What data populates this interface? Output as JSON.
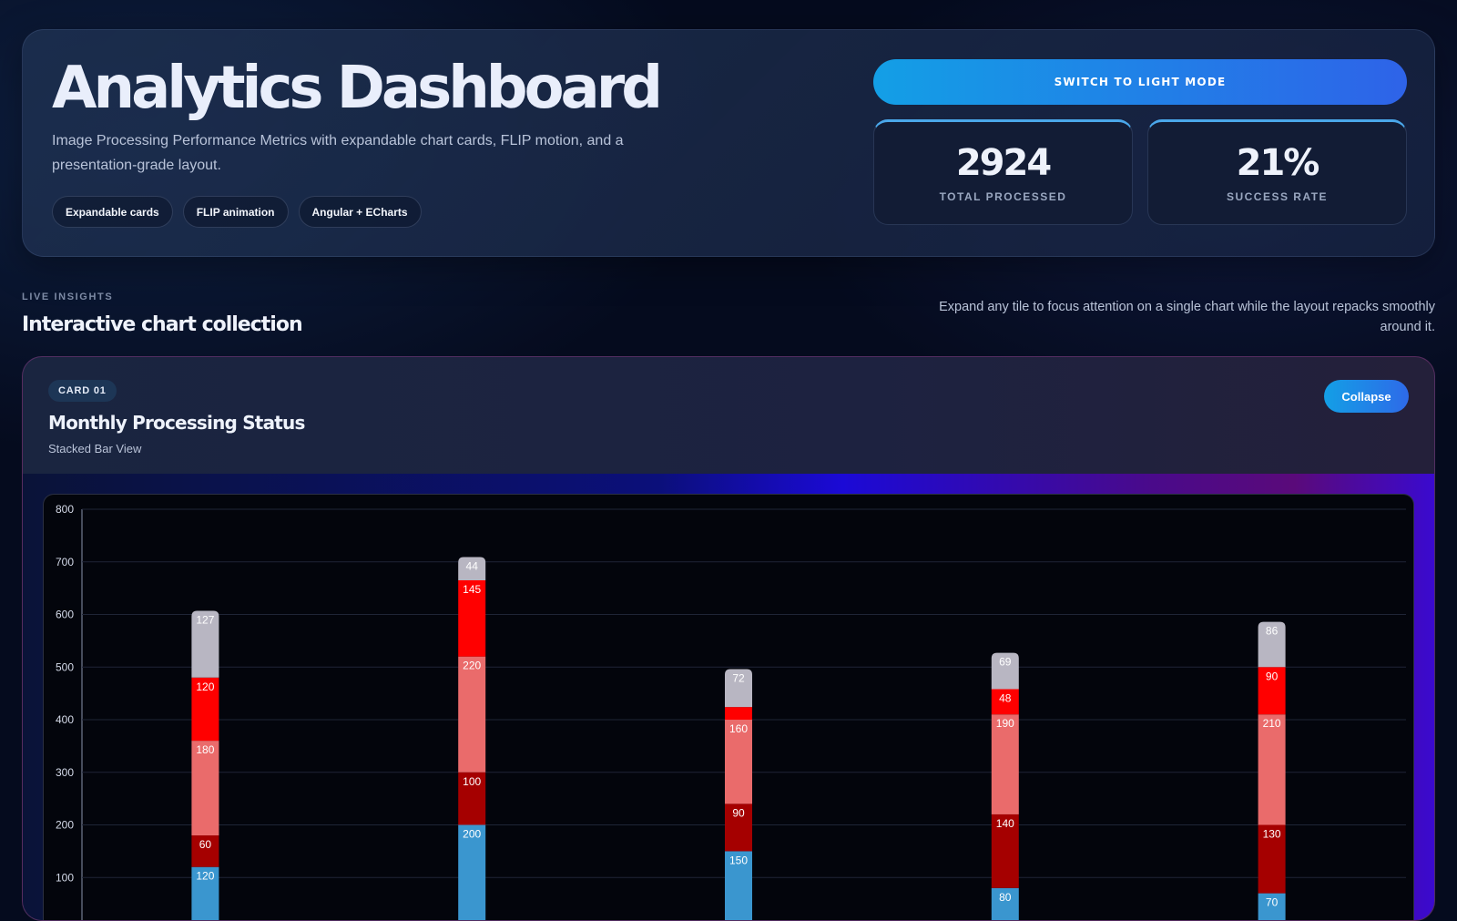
{
  "hero": {
    "title": "Analytics Dashboard",
    "description": "Image Processing Performance Metrics with expandable chart cards, FLIP motion, and a presentation-grade layout.",
    "chips": [
      "Expandable cards",
      "FLIP animation",
      "Angular + ECharts"
    ],
    "theme_button": "SWITCH TO LIGHT MODE",
    "stats": [
      {
        "value": "2924",
        "label": "TOTAL PROCESSED"
      },
      {
        "value": "21%",
        "label": "SUCCESS RATE"
      }
    ]
  },
  "section": {
    "eyebrow": "LIVE INSIGHTS",
    "title": "Interactive chart collection",
    "note": "Expand any tile to focus attention on a single chart while the layout repacks smoothly around it."
  },
  "card": {
    "badge": "CARD 01",
    "title": "Monthly Processing Status",
    "subtitle": "Stacked Bar View",
    "collapse_label": "Collapse"
  },
  "colors": {
    "accent_start": "#139fe6",
    "accent_end": "#2e63e8",
    "series": [
      "#3a96cf",
      "#a50000",
      "#ea6b6b",
      "#ff0000",
      "#b8b6c2"
    ]
  },
  "chart_data": {
    "type": "bar",
    "stacked": true,
    "categories": [
      "",
      "",
      "",
      "",
      ""
    ],
    "series": [
      {
        "values": [
          120,
          200,
          150,
          80,
          70
        ]
      },
      {
        "values": [
          60,
          100,
          90,
          140,
          130
        ]
      },
      {
        "values": [
          180,
          220,
          160,
          190,
          210
        ]
      },
      {
        "values": [
          120,
          145,
          24,
          48,
          90
        ]
      },
      {
        "values": [
          127,
          44,
          72,
          69,
          86
        ]
      }
    ],
    "data_labels": [
      [
        "120",
        "200",
        "150",
        "80",
        "70"
      ],
      [
        "60",
        "100",
        "90",
        "140",
        "130"
      ],
      [
        "180",
        "220",
        "160",
        "190",
        "210"
      ],
      [
        "120",
        "145",
        "",
        "48",
        "90"
      ],
      [
        "127",
        "44",
        "72",
        "69",
        "86"
      ]
    ],
    "y_ticks": [
      "100",
      "200",
      "300",
      "400",
      "500",
      "600",
      "700",
      "800"
    ],
    "ylim": [
      0,
      800
    ],
    "grid": true
  }
}
